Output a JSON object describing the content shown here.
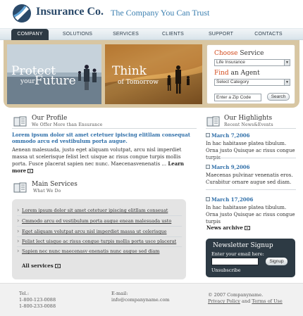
{
  "header": {
    "logo_name": "Insurance Co.",
    "tagline": "The Company You Can Trust"
  },
  "nav": {
    "items": [
      {
        "label": "COMPANY",
        "active": true
      },
      {
        "label": "SOLUTIONS",
        "active": false
      },
      {
        "label": "SERVICES",
        "active": false
      },
      {
        "label": "CLIENTS",
        "active": false
      },
      {
        "label": "SUPPORT",
        "active": false
      },
      {
        "label": "CONTACTS",
        "active": false
      }
    ]
  },
  "banner": {
    "photo1": {
      "big": "Protect",
      "small": "your",
      "big2": "Future"
    },
    "photo2": {
      "big": "Think",
      "small": "of Tomorrow"
    }
  },
  "search": {
    "choose_hl": "Choose",
    "choose_rest": " Service",
    "service_value": "Life Insurance",
    "find_hl": "Find",
    "find_rest": " an Agent",
    "category_value": "Select Category",
    "zip_placeholder": "Enter a Zip Code",
    "button": "Search"
  },
  "profile": {
    "title": "Our Profile",
    "subtitle": "We Offer More than Ensurance",
    "lead": "Lorem ipsum dolor sit amet cetetuer ipiscing elitllam consequat ommodo arcu ed vestibulum porta augue.",
    "body": "Aenean malesuada, justo eget aliquam volutpat, arcu nisl imperdiet massa ut scelerisque felist lect uisque ac risus congue turpis mollis porta. Fusce placerat sapien nec nunc. Maecenasvenenatis ... ",
    "more": "Learn more"
  },
  "services": {
    "title": "Main Services",
    "subtitle": "What We Do",
    "items": [
      "Lorem ipsum dolor sit amet cetetuer ipiscing elitllam conseuat",
      "Cmmodo arcu ed vestibulum porta augue enean malesuada usto",
      "Eget aliquam volutpat  arcu nisl imperdiet massa ut celerisque",
      "Felist lect uisque ac risus congue turpis mollis porta usce placerat",
      "Sapien nec nunc maecenasv enenatis nunc augue sed diam"
    ],
    "all_label": "All services"
  },
  "highlights": {
    "title": "Our Highlights",
    "subtitle": "Recent News&Events",
    "items": [
      {
        "date": "March 7,2006",
        "text": "In hac habitasse platea tibulum. Orna justo Quisque ac risus congue turpis"
      },
      {
        "date": "March 9,2006",
        "text": "Maecenas pulvinar venenatis eros. Curabitur ornare augue sed diam."
      },
      {
        "date": "March 17,2006",
        "text": "In hac habitasse platea tibulum. Orna justo Quisque ac risus congue turpis"
      }
    ],
    "archive_label": "News archive"
  },
  "newsletter": {
    "title": "Newsletter Signup",
    "label": "Enter your email here:",
    "button": "Signup",
    "unsubscribe": "Unsubscribe"
  },
  "footer": {
    "tel_label": "Tel.:",
    "tel1": "1-800-123-0088",
    "tel2": "1-800-233-0088",
    "email_label": "E-mail:",
    "email": "info@companyname.com",
    "copyright": "© 2007 Companyname.",
    "privacy": "Privacy Policy",
    "and": " and ",
    "terms": "Terms of Use"
  },
  "colors": {
    "accent_blue": "#2e6ea8",
    "accent_orange": "#d24a1c",
    "dark_panel": "#2d3a44"
  }
}
